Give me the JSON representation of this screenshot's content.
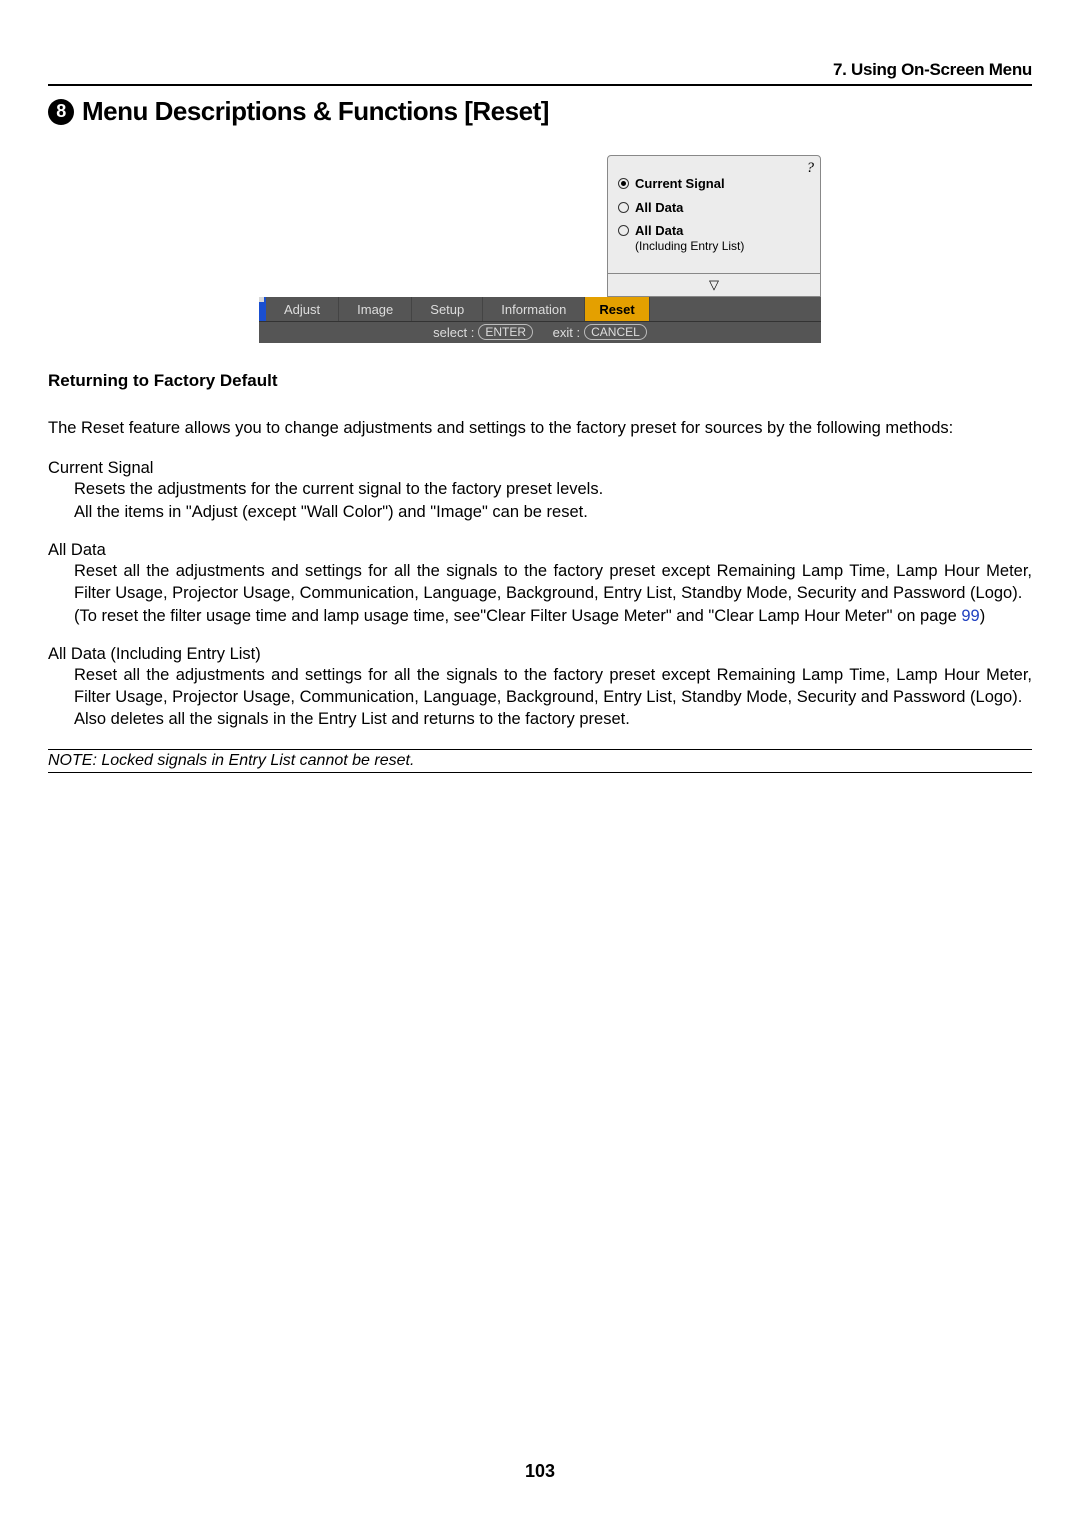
{
  "header": {
    "chapter": "7. Using On-Screen Menu"
  },
  "section": {
    "num": "8",
    "title": "Menu Descriptions & Functions [Reset]"
  },
  "osd": {
    "help_icon": "?",
    "options": [
      {
        "label": "Current Signal",
        "selected": true
      },
      {
        "label": "All Data",
        "selected": false
      },
      {
        "label": "All Data",
        "sublabel": "(Including Entry List)",
        "selected": false
      }
    ],
    "arrow": "▽",
    "tabs": [
      "Adjust",
      "Image",
      "Setup",
      "Information",
      "Reset"
    ],
    "active_tab": "Reset",
    "hints": {
      "select_label": "select :",
      "select_btn": "ENTER",
      "exit_label": "exit :",
      "exit_btn": "CANCEL"
    }
  },
  "subsection": "Returning to Factory Default",
  "intro": "The Reset feature allows you to change adjustments and settings to the factory preset for sources by the following methods:",
  "items": [
    {
      "title": "Current Signal",
      "body": "Resets the adjustments for the current signal to the factory preset levels.\nAll the items in \"Adjust (except \"Wall Color\") and \"Image\" can be reset."
    },
    {
      "title": "All Data",
      "body": "Reset all the adjustments and settings for all the signals to the factory preset except Remaining Lamp Time, Lamp Hour Meter, Filter Usage, Projector Usage, Communication, Language, Background, Entry List, Standby Mode, Security and Password (Logo).\n(To reset the filter usage time and lamp usage time, see\"Clear Filter Usage Meter\" and \"Clear Lamp Hour Meter\" on page ",
      "link": "99",
      "tail": ")"
    },
    {
      "title": "All Data (Including Entry List)",
      "body": "Reset all the adjustments and settings for all the signals to the factory preset except Remaining Lamp Time, Lamp Hour Meter, Filter Usage, Projector Usage, Communication, Language, Background, Entry List, Standby Mode, Security and Password (Logo).\nAlso deletes all the signals in the Entry List and returns to the factory preset."
    }
  ],
  "note": "NOTE: Locked signals in Entry List cannot be reset.",
  "page_number": "103"
}
